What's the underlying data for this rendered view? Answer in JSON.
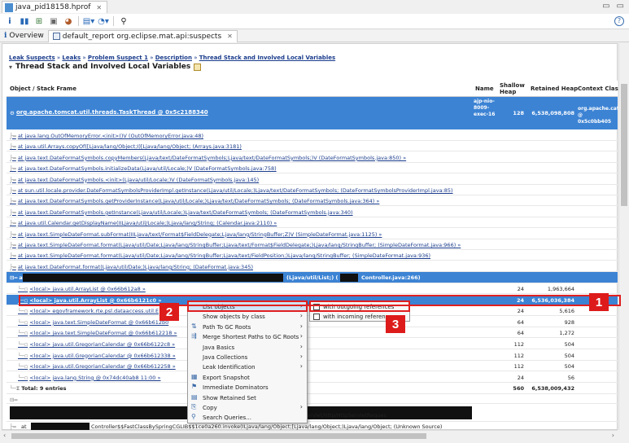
{
  "window": {
    "title": "java_pid18158.hprof"
  },
  "subtabs": [
    {
      "label": "Overview"
    },
    {
      "label": "default_report  org.eclipse.mat.api:suspects"
    }
  ],
  "breadcrumb": {
    "items": [
      "Leak Suspects",
      "Leaks",
      "Problem Suspect 1",
      "Description",
      "Thread Stack and Involved Local Variables"
    ]
  },
  "section_title": "Thread Stack and Involved Local Variables",
  "table": {
    "headers": [
      "Object / Stack Frame",
      "Name",
      "Shallow Heap",
      "Retained Heap",
      "Context Class L"
    ],
    "thread": {
      "label": "org.apache.tomcat.util.threads.TaskThread @ 0x5c2188340",
      "name": "ajp-nio-8009-exec-16",
      "shallow": "128",
      "retained": "6,538,098,808",
      "context": "org.apache.cat @ 0x5c0bb405"
    },
    "frames": [
      "at java.lang.OutOfMemoryError.<init>()V (OutOfMemoryError.java:48)",
      "at java.util.Arrays.copyOf([Ljava/lang/Object;I)[Ljava/lang/Object; (Arrays.java:3181)",
      "at java.text.DateFormatSymbols.copyMembers(Ljava/text/DateFormatSymbols;Ljava/text/DateFormatSymbols;)V (DateFormatSymbols.java:850) »",
      "at java.text.DateFormatSymbols.initializeData(Ljava/util/Locale;)V (DateFormatSymbols.java:758)",
      "at java.text.DateFormatSymbols.<init>(Ljava/util/Locale;)V (DateFormatSymbols.java:145)",
      "at sun.util.locale.provider.DateFormatSymbolsProviderImpl.getInstance(Ljava/util/Locale;)Ljava/text/DateFormatSymbols; (DateFormatSymbolsProviderImpl.java:85)",
      "at java.text.DateFormatSymbols.getProviderInstance(Ljava/util/Locale;)Ljava/text/DateFormatSymbols; (DateFormatSymbols.java:364) »",
      "at java.text.DateFormatSymbols.getInstance(Ljava/util/Locale;)Ljava/text/DateFormatSymbols; (DateFormatSymbols.java:340)",
      "at java.util.Calendar.getDisplayName(IILjava/util/Locale;)Ljava/lang/String; (Calendar.java:2110) »",
      "at java.text.SimpleDateFormat.subFormat(IILjava/text/Format$FieldDelegate;Ljava/lang/StringBuffer;Z)V (SimpleDateFormat.java:1125) »",
      "at java.text.SimpleDateFormat.format(Ljava/util/Date;Ljava/lang/StringBuffer;Ljava/text/Format$FieldDelegate;)Ljava/lang/StringBuffer; (SimpleDateFormat.java:966) »",
      "at java.text.SimpleDateFormat.format(Ljava/util/Date;Ljava/lang/StringBuffer;Ljava/text/FieldPosition;)Ljava/lang/StringBuffer; (SimpleDateFormat.java:936)",
      "at java.text.DateFormat.format(Ljava/util/Date;)Ljava/lang/String; (DateFormat.java:345)"
    ],
    "controller_frame": {
      "left": "at",
      "right": "(Ljava/util/List;) (",
      "tail": "Controller.java:266)"
    },
    "locals": [
      {
        "label": "<local> java.util.ArrayList @ 0x66b612a8 »",
        "shallow": "24",
        "retained": "1,963,664"
      },
      {
        "label": "<local> java.util.ArrayList @ 0x66b6121c0 »",
        "shallow": "24",
        "retained": "6,536,036,384"
      },
      {
        "label": "<local> eqovframework.rte.psl.dataaccess.util.E",
        "shallow": "24",
        "retained": "5,616"
      },
      {
        "label": "<local> java.text.SimpleDateFormat @ 0x66b612b0",
        "shallow": "64",
        "retained": "928"
      },
      {
        "label": "<local> java.text.SimpleDateFormat @ 0x66b612218 »",
        "shallow": "64",
        "retained": "1,272"
      },
      {
        "label": "<local> java.util.GregorianCalendar @ 0x66b6122c8 »",
        "shallow": "112",
        "retained": "504"
      },
      {
        "label": "<local> java.util.GregorianCalendar @ 0x66b612338 »",
        "shallow": "112",
        "retained": "504"
      },
      {
        "label": "<local> java.util.GregorianCalendar @ 0x66b612258 »",
        "shallow": "112",
        "retained": "504"
      },
      {
        "label": "<local> java.lang.String @ 0x74dc40ab8 11:00 »",
        "shallow": "24",
        "retained": "56"
      }
    ],
    "total": {
      "label": "Total: 9 entries",
      "shallow": "560",
      "retained": "6,538,009,432"
    },
    "bottom_frame_1": ")Ljavax/servlet/http/HttpServletReques",
    "bottom_frame_2": "Controller$$FastClassBySpringCGLIB$$1ce0a260.invoke(ILjava/lang/Object;[Ljava/lang/Object;)Ljava/lang/Object; (Unknown Source)",
    "bottom_frame_2_prefix": "at"
  },
  "context_menu": {
    "items": [
      {
        "label": "List objects",
        "submenu": true
      },
      {
        "label": "Show objects by class",
        "submenu": true
      },
      {
        "label": "Path To GC Roots",
        "submenu": true
      },
      {
        "label": "Merge Shortest Paths to GC Roots",
        "submenu": true
      },
      {
        "label": "Java Basics",
        "submenu": true
      },
      {
        "label": "Java Collections",
        "submenu": true
      },
      {
        "label": "Leak Identification",
        "submenu": true
      },
      {
        "label": "Export Snapshot",
        "submenu": false
      },
      {
        "label": "Immediate Dominators",
        "submenu": false
      },
      {
        "label": "Show Retained Set",
        "submenu": false
      },
      {
        "label": "Copy",
        "submenu": true
      },
      {
        "label": "Search Queries...",
        "submenu": false
      }
    ]
  },
  "submenu": {
    "items": [
      "with outgoing references",
      "with incoming references"
    ]
  },
  "badges": [
    "1",
    "2",
    "3"
  ],
  "colors": {
    "selection": "#3c83d4",
    "annotation": "#dd1b1b",
    "link": "#1a3c8c"
  }
}
